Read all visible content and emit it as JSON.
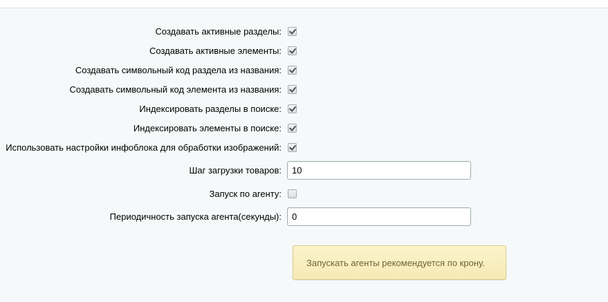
{
  "settings": {
    "checkboxes": [
      {
        "label": "Создавать активные разделы:",
        "checked": true
      },
      {
        "label": "Создавать активные элементы:",
        "checked": true
      },
      {
        "label": "Создавать символьный код раздела из названия:",
        "checked": true
      },
      {
        "label": "Создавать символьный код элемента из названия:",
        "checked": true
      },
      {
        "label": "Индексировать разделы в поиске:",
        "checked": true
      },
      {
        "label": "Индексировать элементы в поиске:",
        "checked": true
      },
      {
        "label": "Использовать настройки инфоблока для обработки изображений:",
        "checked": true
      }
    ],
    "step": {
      "label": "Шаг загрузки товаров:",
      "value": "10"
    },
    "agent": {
      "label": "Запуск по агенту:",
      "checked": false
    },
    "period": {
      "label": "Периодичность запуска агента(секунды):",
      "value": "0"
    },
    "note": "Запускать агенты рекомендуется по крону."
  }
}
